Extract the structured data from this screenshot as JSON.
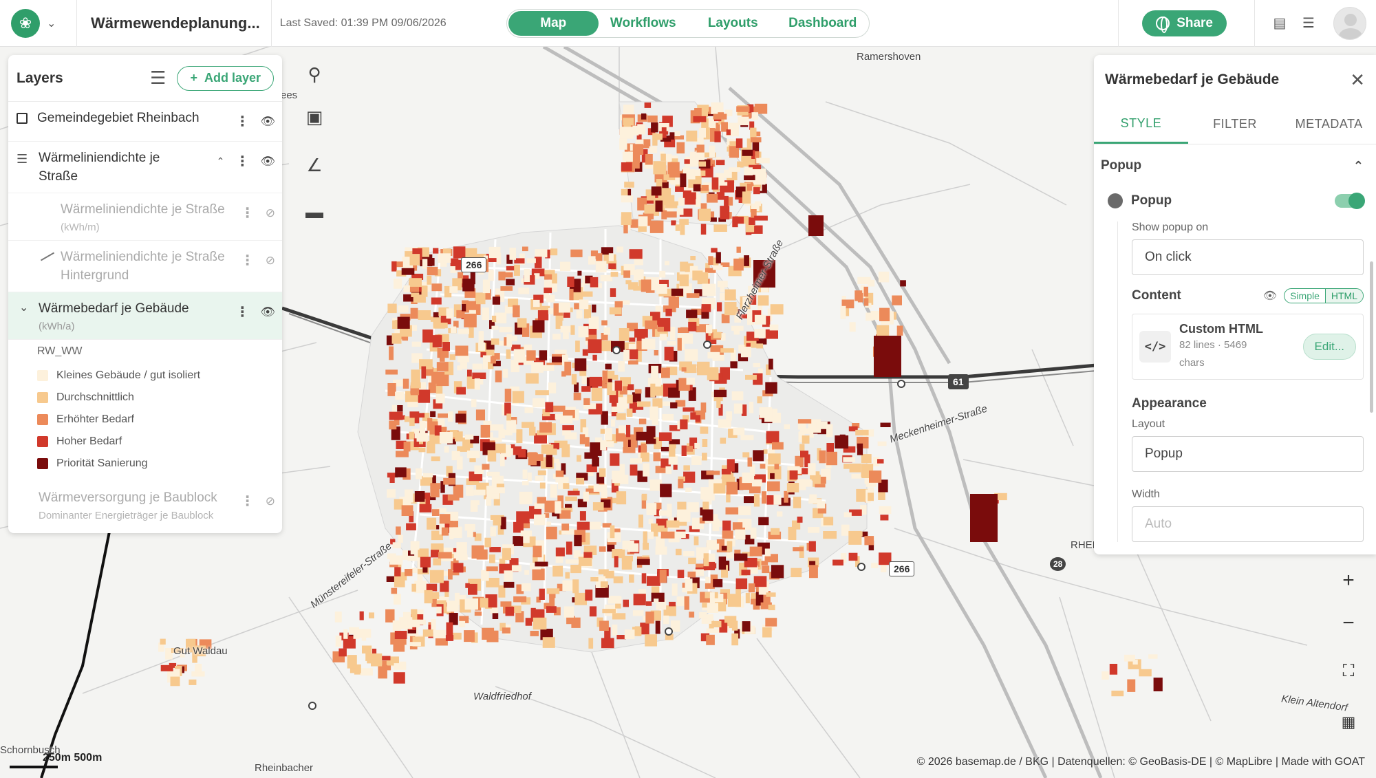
{
  "app": {
    "project_title": "Wärmewendeplanung...",
    "last_saved": "Last Saved: 01:39 PM 09/06/2026"
  },
  "nav": {
    "tabs": [
      "Map",
      "Workflows",
      "Layouts",
      "Dashboard"
    ],
    "active": "Map"
  },
  "share": {
    "label": "Share"
  },
  "layers_panel": {
    "title": "Layers",
    "add_layer_label": "Add layer",
    "layers": [
      {
        "name": "Gemeindegebiet Rheinbach",
        "visible": true
      },
      {
        "name": "Wärmeliniendichte je Straße",
        "visible": true
      },
      {
        "name": "Wärmeliniendichte je Straße",
        "unit": "(kWh/m)",
        "visible": false
      },
      {
        "name": "Wärmeliniendichte je Straße Hintergrund",
        "visible": false
      },
      {
        "name": "Wärmebedarf je Gebäude",
        "unit": "(kWh/a)",
        "visible": true
      },
      {
        "name": "Wärmeversorgung je Baublock",
        "unit": "Dominanter Energieträger je Baublock",
        "visible": false
      }
    ],
    "legend": {
      "field": "RW_WW",
      "items": [
        {
          "label": "Kleines Gebäude / gut isoliert",
          "color": "#fdf1dc"
        },
        {
          "label": "Durchschnittlich",
          "color": "#f7c98e"
        },
        {
          "label": "Erhöhter Bedarf",
          "color": "#ec8a5a"
        },
        {
          "label": "Hoher Bedarf",
          "color": "#d1392b"
        },
        {
          "label": "Priorität Sanierung",
          "color": "#7a0c0c"
        }
      ]
    }
  },
  "style_panel": {
    "title": "Wärmebedarf je Gebäude",
    "tabs": [
      "STYLE",
      "FILTER",
      "METADATA"
    ],
    "active_tab": "STYLE",
    "section": "Popup",
    "popup_label": "Popup",
    "show_popup_on_label": "Show popup on",
    "show_popup_on_value": "On click",
    "content_label": "Content",
    "content_modes": [
      "Simple",
      "HTML"
    ],
    "custom_html": {
      "title": "Custom HTML",
      "meta": "82 lines · 5469 chars",
      "edit_label": "Edit..."
    },
    "appearance_label": "Appearance",
    "layout_label": "Layout",
    "layout_value": "Popup",
    "width_label": "Width",
    "width_value": "Auto"
  },
  "map_labels": {
    "rammershoven": "Ramershoven",
    "gut_waldau": "Gut Waldau",
    "waldfriedhof": "Waldfriedhof",
    "schornbusch": "Schornbusch",
    "rheinbacher": "Rheinbacher",
    "meckenheimer": "Meckenheimer-Straße",
    "muenstereifeler": "Münstereifeler-Straße",
    "flerzheimer": "Flerzheimer-Straße",
    "kleinaltendorf": "Klein Altendorf",
    "rhei": "RHEI",
    "see": "ees",
    "shield_266a": "266",
    "shield_266b": "266",
    "shield_61": "61",
    "shield_28": "28"
  },
  "scale": {
    "label": "250m 500m"
  },
  "attribution": "© 2026 basemap.de / BKG | Datenquellen: © GeoBasis-DE | © MapLibre | Made with GOAT",
  "colors": {
    "brand": "#3aa676",
    "heat_low": "#fdf1dc",
    "heat_avg": "#f7c98e",
    "heat_high": "#ec8a5a",
    "heat_veryhigh": "#d1392b",
    "heat_priority": "#7a0c0c"
  }
}
